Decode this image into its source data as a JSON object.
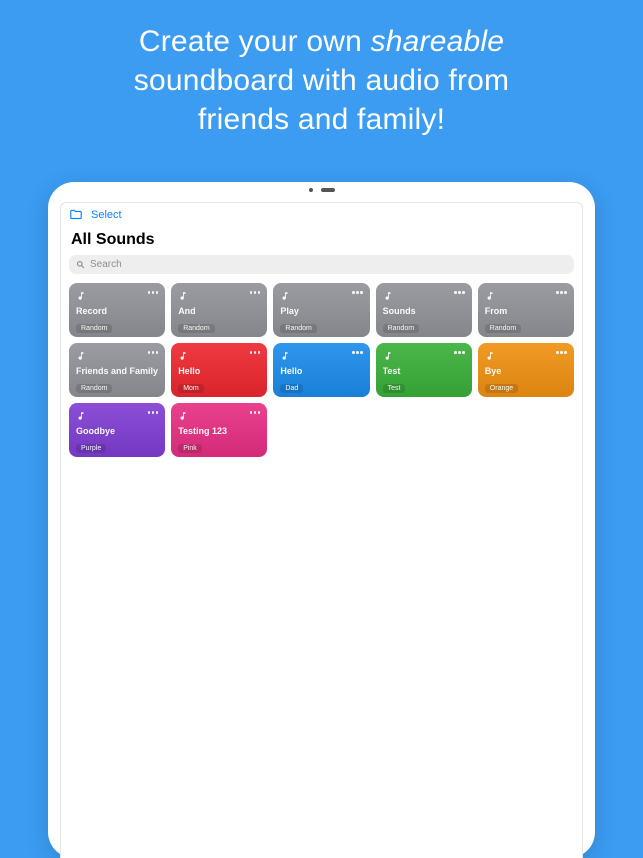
{
  "promo": {
    "line1_a": "Create your own ",
    "line1_em": "shareable",
    "line2": "soundboard with audio from",
    "line3": "friends and family!"
  },
  "toolbar": {
    "select_label": "Select"
  },
  "header": {
    "title": "All Sounds"
  },
  "search": {
    "placeholder": "Search"
  },
  "colors": {
    "gray": "#9a9ca1",
    "red": "#ef3a42",
    "blue": "#2f96ee",
    "green": "#4bb64a",
    "orange": "#f29a26",
    "purple": "#8a4fd6",
    "pink": "#e9418e"
  },
  "tiles": [
    {
      "title": "Record",
      "sub": "Random",
      "colorKey": "gray"
    },
    {
      "title": "And",
      "sub": "Random",
      "colorKey": "gray"
    },
    {
      "title": "Play",
      "sub": "Random",
      "colorKey": "gray"
    },
    {
      "title": "Sounds",
      "sub": "Random",
      "colorKey": "gray"
    },
    {
      "title": "From",
      "sub": "Random",
      "colorKey": "gray"
    },
    {
      "title": "Friends and Family",
      "sub": "Random",
      "colorKey": "gray"
    },
    {
      "title": "Hello",
      "sub": "Mom",
      "colorKey": "red"
    },
    {
      "title": "Hello",
      "sub": "Dad",
      "colorKey": "blue"
    },
    {
      "title": "Test",
      "sub": "Test",
      "colorKey": "green"
    },
    {
      "title": "Bye",
      "sub": "Orange",
      "colorKey": "orange"
    },
    {
      "title": "Goodbye",
      "sub": "Purple",
      "colorKey": "purple"
    },
    {
      "title": "Testing 123",
      "sub": "Pink",
      "colorKey": "pink"
    }
  ]
}
